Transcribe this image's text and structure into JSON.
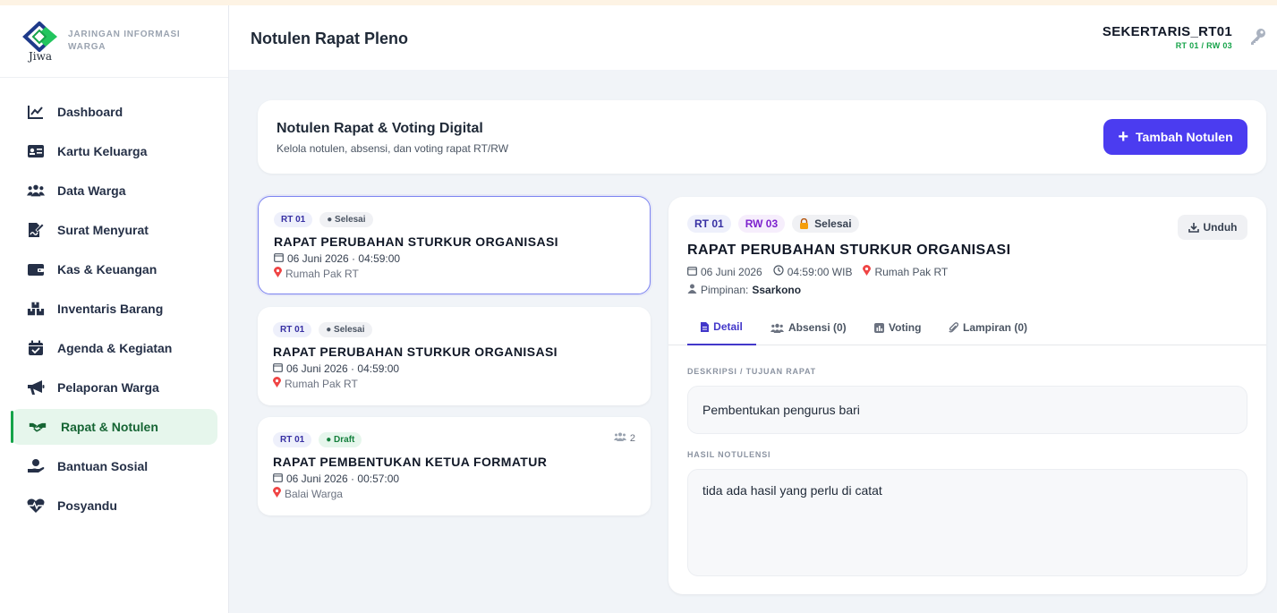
{
  "app": {
    "logo_word": "Jiwa",
    "brand_text": "JARINGAN INFORMASI WARGA"
  },
  "sidebar": {
    "items": [
      {
        "label": "Dashboard"
      },
      {
        "label": "Kartu Keluarga"
      },
      {
        "label": "Data Warga"
      },
      {
        "label": "Surat Menyurat"
      },
      {
        "label": "Kas & Keuangan"
      },
      {
        "label": "Inventaris Barang"
      },
      {
        "label": "Agenda & Kegiatan"
      },
      {
        "label": "Pelaporan Warga"
      },
      {
        "label": "Rapat & Notulen",
        "active": true
      },
      {
        "label": "Bantuan Sosial"
      },
      {
        "label": "Posyandu"
      }
    ]
  },
  "header": {
    "title": "Notulen Rapat Pleno",
    "user_name": "SEKERTARIS_RT01",
    "user_area": "RT 01 / RW 03"
  },
  "banner": {
    "title": "Notulen Rapat & Voting Digital",
    "subtitle": "Kelola notulen, absensi, dan voting rapat RT/RW",
    "add_button": "Tambah Notulen"
  },
  "meetings": [
    {
      "rt": "RT 01",
      "status": "● Selesai",
      "title": "RAPAT PERUBAHAN STURKUR ORGANISASI",
      "datetime": "06 Juni 2026 · 04:59:00",
      "place": "Rumah Pak RT"
    },
    {
      "rt": "RT 01",
      "status": "● Selesai",
      "title": "RAPAT PERUBAHAN STURKUR ORGANISASI",
      "datetime": "06 Juni 2026 · 04:59:00",
      "place": "Rumah Pak RT"
    },
    {
      "rt": "RT 01",
      "status": "● Draft",
      "title": "RAPAT PEMBENTUKAN KETUA FORMATUR",
      "datetime": "06 Juni 2026 · 00:57:00",
      "place": "Balai Warga",
      "attendees": "2"
    }
  ],
  "detail": {
    "rt": "RT 01",
    "rw": "RW 03",
    "status": "Selesai",
    "download": "Unduh",
    "title": "RAPAT PERUBAHAN STURKUR ORGANISASI",
    "date": "06 Juni 2026",
    "time": "04:59:00 WIB",
    "place": "Rumah Pak RT",
    "leader_label": "Pimpinan:",
    "leader": "Ssarkono",
    "tabs": [
      {
        "label": "Detail"
      },
      {
        "label": "Absensi (0)"
      },
      {
        "label": "Voting"
      },
      {
        "label": "Lampiran (0)"
      }
    ],
    "desc_label": "DESKRIPSI / TUJUAN RAPAT",
    "desc": "Pembentukan pengurus bari",
    "result_label": "HASIL NOTULENSI",
    "result": "tida ada hasil yang perlu di catat"
  },
  "colors": {
    "accent": "#4b3cf0",
    "active_green": "#16a34a",
    "active_bg": "#e6f6ec"
  }
}
